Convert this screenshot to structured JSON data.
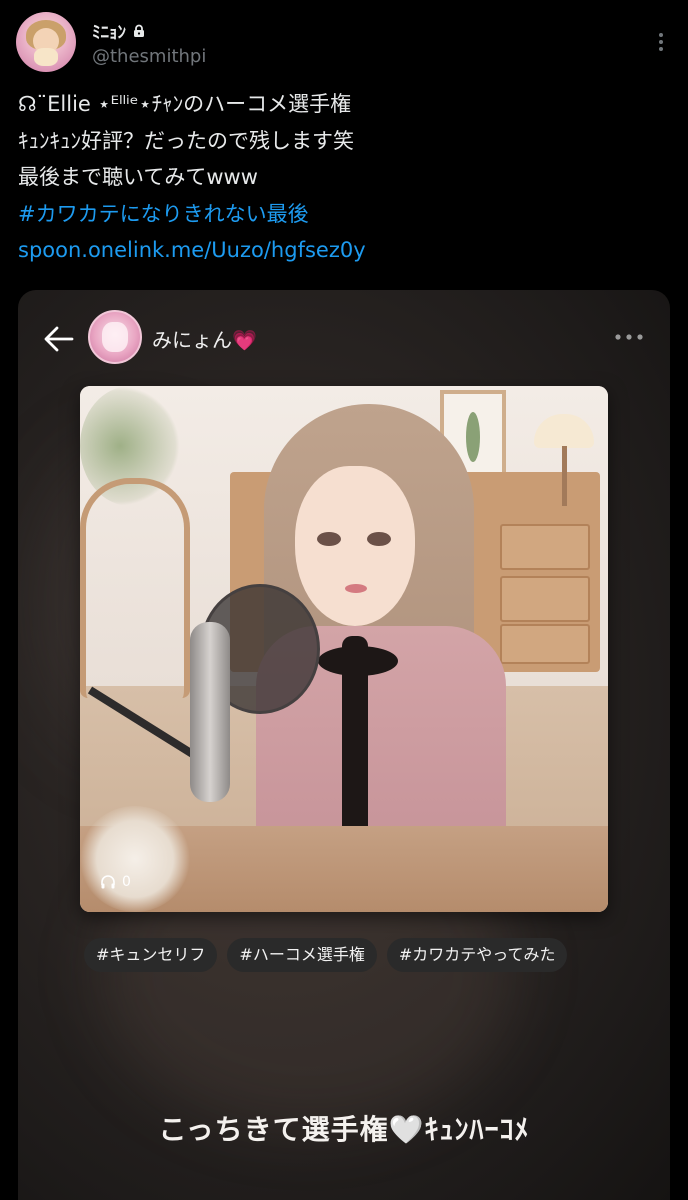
{
  "tweet": {
    "display_name": "ﾐﾆｮﾝ",
    "handle": "@thesmithpi",
    "lines": [
      "☊¨Ellie ⋆ᴱˡˡⁱᵉ⋆ﾁｬﾝのハーコメ選手権",
      "ｷｭﾝｷｭﾝ好評？だったので残します笑",
      "最後まで聴いてみてwww"
    ],
    "hashtag": "#カワカテになりきれない最後",
    "link": "spoon.onelink.me/Uuzo/hgfsez0y"
  },
  "media": {
    "username": "みにょん",
    "heart": "💗",
    "play_count": "0",
    "tags": [
      "#キュンセリフ",
      "#ハーコメ選手権",
      "#カワカテやってみた"
    ],
    "caption": "こっちきて選手権🤍ｷｭﾝﾊｰｺﾒ"
  },
  "colors": {
    "background": "#000000",
    "link": "#1d9bf0",
    "muted": "#71767b",
    "text": "#e7e9ea"
  },
  "icons": [
    "lock-icon",
    "more-icon",
    "back-icon",
    "headphone-icon"
  ]
}
